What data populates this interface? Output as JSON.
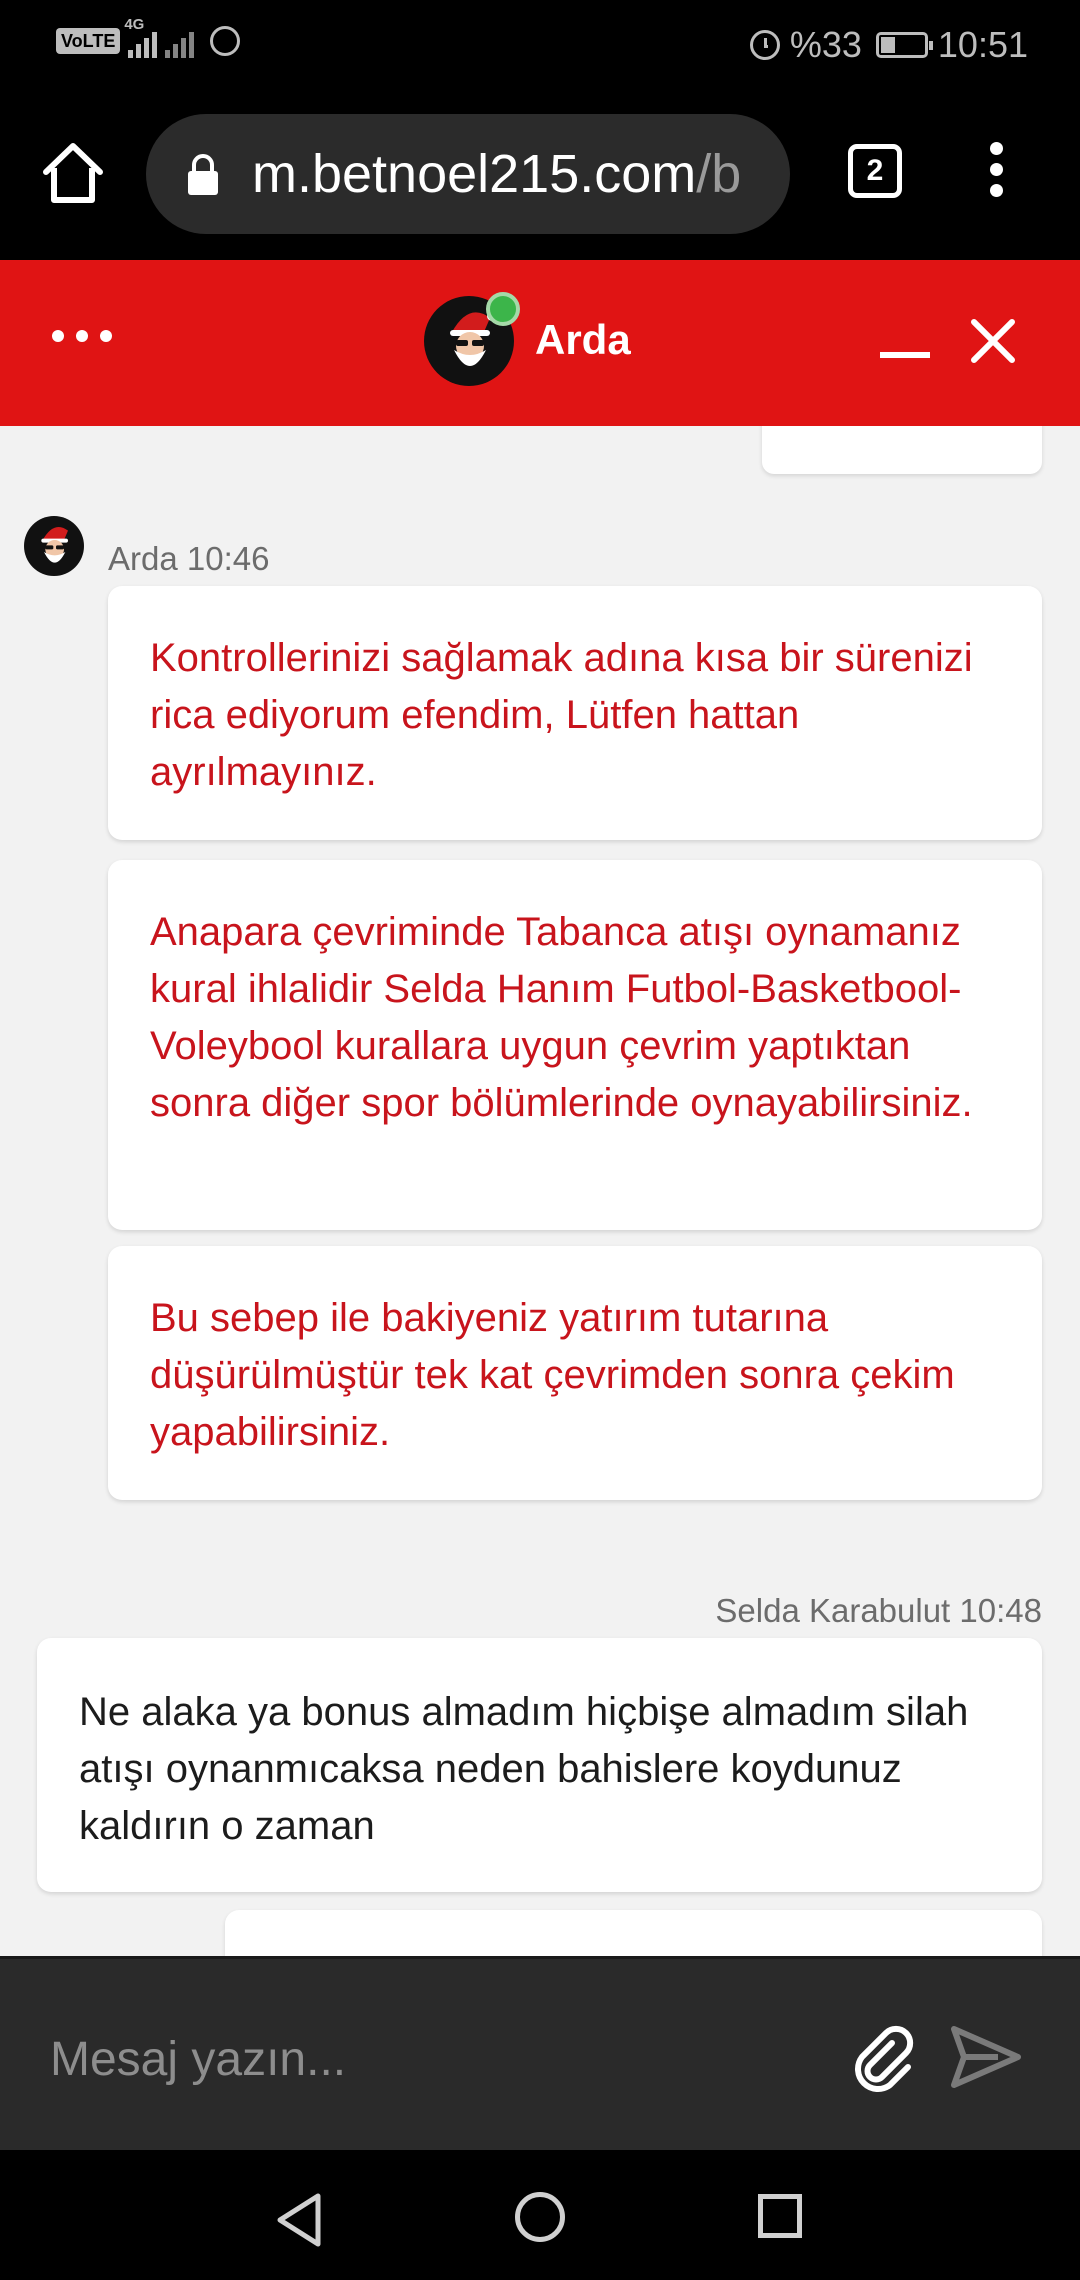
{
  "status_bar": {
    "volte": "VoLTE",
    "network": "4G",
    "battery_percent": "%33",
    "time": "10:51"
  },
  "browser": {
    "url_main": "m.betnoel215.com",
    "url_rest": "/b",
    "tab_count": "2"
  },
  "chat_header": {
    "agent_name": "Arda",
    "online": true,
    "accent_color": "#e01414"
  },
  "messages": [
    {
      "sender": "Arda",
      "time": "10:46",
      "bubbles": [
        "Kontrollerinizi sağlamak adına kısa bir sürenizi rica ediyorum efendim, Lütfen hattan ayrılmayınız.",
        "Anapara çevriminde Tabanca atışı oynamanız kural ihlalidir Selda Hanım Futbol-Basketbool-Voleybool kurallara uygun çevrim yaptıktan sonra diğer spor bölümlerinde oynayabilirsiniz.",
        "Bu sebep ile bakiyeniz yatırım tutarına düşürülmüştür tek kat çevrimden sonra çekim yapabilirsiniz."
      ]
    },
    {
      "sender": "Selda Karabulut",
      "time": "10:48",
      "bubbles": [
        "Ne alaka ya bonus almadım hiçbişe almadım silah atışı oynanmıcaksa neden bahislere koydunuz kaldırın o zaman"
      ]
    }
  ],
  "input": {
    "placeholder": "Mesaj yazın..."
  },
  "icons": [
    "home-icon",
    "lock-icon",
    "tabs-icon",
    "more-vert-icon",
    "more-horiz-icon",
    "minimize-icon",
    "close-icon",
    "attach-icon",
    "send-icon",
    "nav-back-icon",
    "nav-home-icon",
    "nav-recent-icon"
  ]
}
